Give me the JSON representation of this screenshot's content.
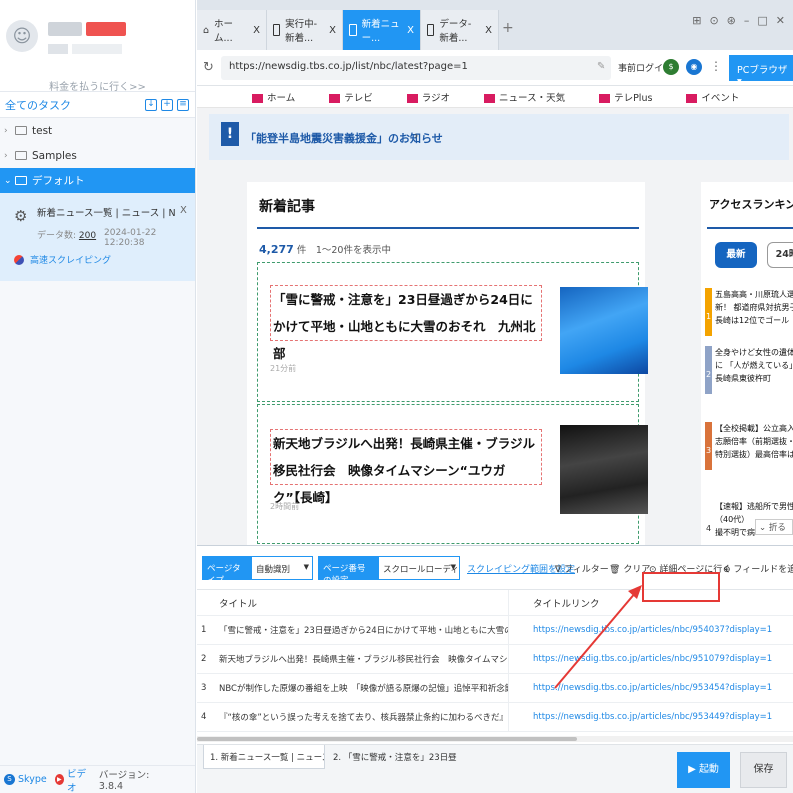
{
  "sidebar": {
    "pay_link": "料金を払うに行く>>",
    "tasks_header": "全てのタスク",
    "tree": [
      {
        "label": "test",
        "active": false
      },
      {
        "label": "Samples",
        "active": false
      },
      {
        "label": "デフォルト",
        "active": true
      }
    ],
    "task": {
      "name": "新着ニュース一覧 | ニュース | NBC長崎放送...",
      "count_label": "データ数:",
      "count": "200",
      "date": "2024-01-22 12:20:38",
      "scrape_label": "高速スクレイピング"
    },
    "footer": {
      "skype": "Skype",
      "video": "ビデオ",
      "version": "バージョン: 3.8.4"
    }
  },
  "browser": {
    "tabs": [
      {
        "label": "ホーム...",
        "icon": "home-icon",
        "active": false
      },
      {
        "label": "実行中-新着...",
        "icon": "page-icon",
        "active": false
      },
      {
        "label": "新着ニュー...",
        "icon": "page-icon",
        "active": true
      },
      {
        "label": "データ-新着...",
        "icon": "page-icon",
        "active": false
      }
    ],
    "url": "https://newsdig.tbs.co.jp/list/nbc/latest?page=1",
    "login": "事前ログイン",
    "pc_browser": "PCブラウザ"
  },
  "webpage": {
    "nav": [
      "ホーム",
      "テレビ",
      "ラジオ",
      "ニュース・天気",
      "テレPlus",
      "イベント"
    ],
    "notice": "「能登半島地震災害義援金」のお知らせ",
    "section_title": "新着記事",
    "count_num": "4,277",
    "count_text": "件　1～20件を表示中",
    "articles": [
      {
        "title": "「雪に警戒・注意を」23日昼過ぎから24日にかけて平地・山地ともに大雪のおそれ　九州北部",
        "time": "21分前"
      },
      {
        "title": "新天地ブラジルへ出発！長崎県主催・ブラジル移民社行会　映像タイムマシーン“ユウガク”【長崎】",
        "time": "2時間前"
      }
    ],
    "ranking_title": "アクセスランキング",
    "rank_tabs": [
      "最新",
      "24時"
    ],
    "rank_items": [
      {
        "num": "1",
        "lines": [
          "五島高高・川原琉人選手",
          "新！ 都道府県対抗男子",
          "長崎は12位でゴール"
        ],
        "color": "#f4a300"
      },
      {
        "num": "2",
        "lines": [
          "全身やけど女性の遺体が",
          "に 「人が燃えている」",
          "長崎県東彼杵町"
        ],
        "color": "#8fa3c7"
      },
      {
        "num": "3",
        "lines": [
          "【全校掲載】公立高入試",
          "志願倍率（前期選抜・",
          "特別選抜）最高倍率は"
        ],
        "color": "#d9733b"
      },
      {
        "num": "4",
        "lines": [
          "【速報】逃船所で男性作",
          "（40代）",
          "撮不明で病"
        ],
        "color": "#ffffff"
      }
    ],
    "fold": "折る"
  },
  "panel": {
    "page_type_label": "ページタイプ",
    "page_type_value": "自動識別",
    "page_num_label": "ページ番号の設定",
    "page_num_value": "スクロールローディング",
    "scrape_range": "スクレイピング範囲を設定",
    "filter": "フィルター",
    "clear": "クリア",
    "detail": "詳細ページに行く",
    "add_field": "フィールドを追加",
    "columns": [
      "タイトル",
      "タイトルリンク"
    ],
    "rows": [
      {
        "idx": "1",
        "title": "「雪に警戒・注意を」23日昼過ぎから24日にかけて平地・山地ともに大雪のおそれ　九州北部",
        "link": "https://newsdig.tbs.co.jp/articles/nbc/954037?display=1"
      },
      {
        "idx": "2",
        "title": "新天地ブラジルへ出発！長崎県主催・ブラジル移民社行会　映像タイムマシーン“ユウガク”【...",
        "link": "https://newsdig.tbs.co.jp/articles/nbc/951079?display=1"
      },
      {
        "idx": "3",
        "title": "NBCが制作した原爆の番組を上映　「映像が語る原爆の記憶」追悼平和祈念館20周年イベント",
        "link": "https://newsdig.tbs.co.jp/articles/nbc/953454?display=1"
      },
      {
        "idx": "4",
        "title": "『“核の傘”という誤った考えを捨て去り、核兵器禁止条約に加わるべきだ』ICANメリッサ・...",
        "link": "https://newsdig.tbs.co.jp/articles/nbc/953449?display=1"
      }
    ],
    "bottom_tabs": [
      "1. 新着ニュース一覧 | ニュース | N...",
      "2. 「雪に警戒・注意を」23日昼過..."
    ],
    "start": "起動",
    "save": "保存"
  },
  "colors": {
    "accent": "#2196f3",
    "highlight": "#e53935"
  }
}
